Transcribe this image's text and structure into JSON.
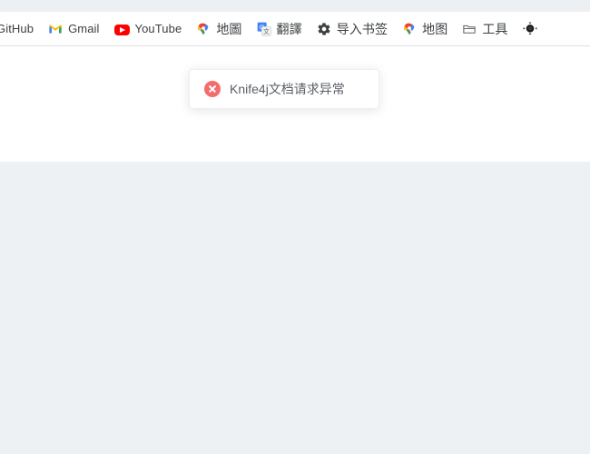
{
  "browser": {
    "bookmarks": [
      {
        "label": "GitHub",
        "icon": "github-icon",
        "icon_visible": false,
        "truncated": true
      },
      {
        "label": "Gmail",
        "icon": "gmail-icon",
        "icon_visible": true,
        "truncated": false
      },
      {
        "label": "YouTube",
        "icon": "youtube-icon",
        "icon_visible": true,
        "truncated": false
      },
      {
        "label": "地圖",
        "icon": "maps-pin-icon",
        "icon_visible": true,
        "truncated": false
      },
      {
        "label": "翻譯",
        "icon": "translate-icon",
        "icon_visible": true,
        "truncated": false
      },
      {
        "label": "导入书签",
        "icon": "gear-icon",
        "icon_visible": true,
        "truncated": false
      },
      {
        "label": "地图",
        "icon": "maps-pin-icon",
        "icon_visible": true,
        "truncated": false
      },
      {
        "label": "工具",
        "icon": "folder-icon",
        "icon_visible": true,
        "truncated": false
      },
      {
        "label": "",
        "icon": "dark-pin-icon",
        "icon_visible": true,
        "truncated": true
      }
    ]
  },
  "toast": {
    "message": "Knife4j文档请求异常",
    "icon": "error-circle-icon",
    "type": "error",
    "accent_color": "#f56c6c",
    "text_color": "#5a5e66",
    "background_color": "#ffffff"
  },
  "page": {
    "header_background": "#ffffff",
    "body_background": "#eef1f3"
  }
}
